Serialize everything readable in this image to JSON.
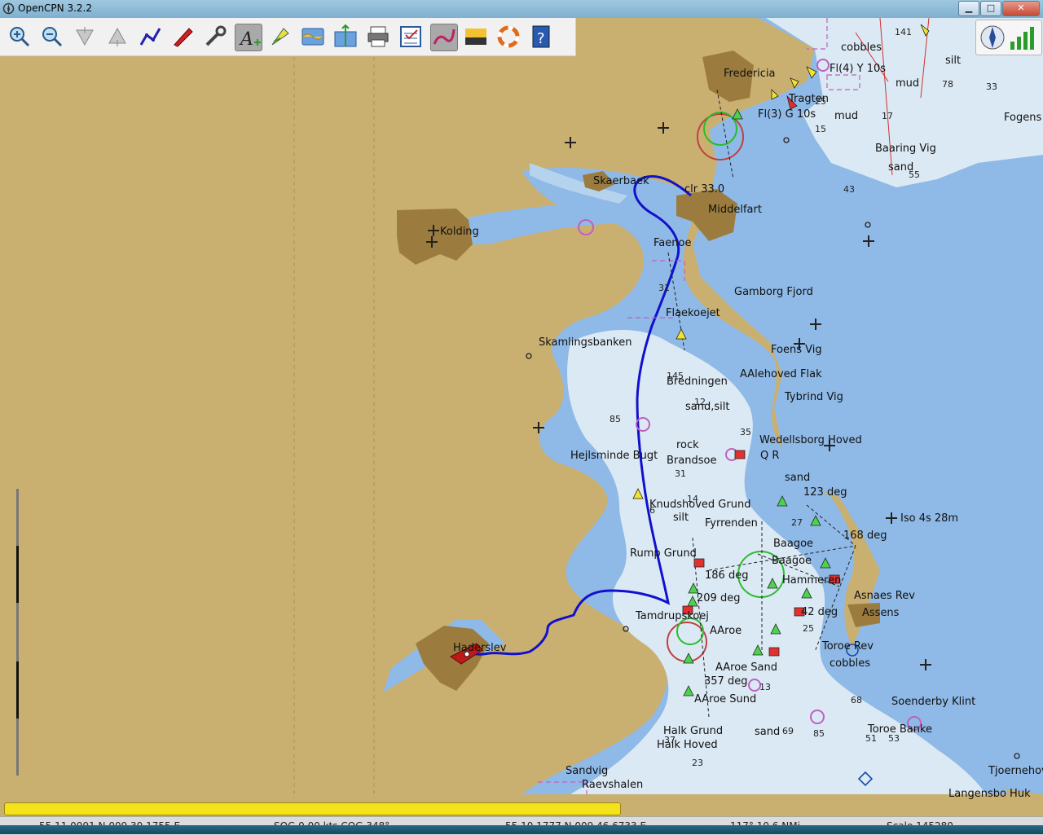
{
  "window": {
    "title": "OpenCPN 3.2.2",
    "minimize_glyph": "▁",
    "maximize_glyph": "□",
    "close_glyph": "✕"
  },
  "toolbar": {
    "tools": [
      {
        "name": "zoom-in",
        "icon": "zoom-in-icon"
      },
      {
        "name": "zoom-out",
        "icon": "zoom-out-icon"
      },
      {
        "name": "scale-in",
        "icon": "scale-in-icon"
      },
      {
        "name": "scale-out",
        "icon": "scale-out-icon"
      },
      {
        "name": "route",
        "icon": "route-icon"
      },
      {
        "name": "auto-follow",
        "icon": "ship-icon"
      },
      {
        "name": "settings",
        "icon": "settings-icon"
      },
      {
        "name": "text",
        "icon": "text-icon",
        "active": true
      },
      {
        "name": "current",
        "icon": "current-icon"
      },
      {
        "name": "tide",
        "icon": "tide-icon"
      },
      {
        "name": "ais",
        "icon": "ais-icon"
      },
      {
        "name": "print",
        "icon": "print-icon"
      },
      {
        "name": "route-manager",
        "icon": "route-manager-icon"
      },
      {
        "name": "track",
        "icon": "track-icon",
        "active": true
      },
      {
        "name": "color-scheme",
        "icon": "color-scheme-icon"
      },
      {
        "name": "mob",
        "icon": "mob-icon"
      },
      {
        "name": "help",
        "icon": "help-icon"
      }
    ]
  },
  "map": {
    "labels": [
      {
        "text": "Fredericia"
      },
      {
        "text": "Fl(4) Y 10s"
      },
      {
        "text": "Tragten"
      },
      {
        "text": "Fl(3) G 10s"
      },
      {
        "text": "cobbles"
      },
      {
        "text": "silt"
      },
      {
        "text": "mud"
      },
      {
        "text": "mud"
      },
      {
        "text": "Fogens"
      },
      {
        "text": "Baaring Vig"
      },
      {
        "text": "sand"
      },
      {
        "text": "Skaerbaek"
      },
      {
        "text": "clr 33.0"
      },
      {
        "text": "Middelfart"
      },
      {
        "text": "Kolding"
      },
      {
        "text": "Faenoe"
      },
      {
        "text": "Gamborg Fjord"
      },
      {
        "text": "Flaekoejet"
      },
      {
        "text": "Skamlingsbanken"
      },
      {
        "text": "Foens Vig"
      },
      {
        "text": "AAlehoved Flak"
      },
      {
        "text": "Bredningen"
      },
      {
        "text": "Tybrind Vig"
      },
      {
        "text": "sand,silt"
      },
      {
        "text": "Wedellsborg Hoved"
      },
      {
        "text": "rock"
      },
      {
        "text": "Q R"
      },
      {
        "text": "Hejlsminde Bugt"
      },
      {
        "text": "Brandsoe"
      },
      {
        "text": "sand"
      },
      {
        "text": "123 deg"
      },
      {
        "text": "Knudshoved Grund"
      },
      {
        "text": "silt"
      },
      {
        "text": "Iso 4s 28m"
      },
      {
        "text": "Fyrrenden"
      },
      {
        "text": "168 deg"
      },
      {
        "text": "Baagoe"
      },
      {
        "text": "Rump Grund"
      },
      {
        "text": "Baagoe"
      },
      {
        "text": "186 deg"
      },
      {
        "text": "Hammeren"
      },
      {
        "text": "Asnaes Rev"
      },
      {
        "text": "209 deg"
      },
      {
        "text": "42 deg"
      },
      {
        "text": "Assens"
      },
      {
        "text": "Tamdrupskoej"
      },
      {
        "text": "AAroe"
      },
      {
        "text": "Haderslev"
      },
      {
        "text": "Toroe Rev"
      },
      {
        "text": "cobbles"
      },
      {
        "text": "AAroe Sand"
      },
      {
        "text": "357 deg"
      },
      {
        "text": "AAroe Sund"
      },
      {
        "text": "Soenderby Klint"
      },
      {
        "text": "Halk Grund"
      },
      {
        "text": "sand"
      },
      {
        "text": "Toroe Banke"
      },
      {
        "text": "Halk Hoved"
      },
      {
        "text": "Sandvig"
      },
      {
        "text": "Tjoernehoved"
      },
      {
        "text": "Raevshalen"
      },
      {
        "text": "Langensbo Huk"
      }
    ],
    "soundings": [
      "141",
      "78",
      "33",
      "43",
      "55",
      "15",
      "17",
      "25",
      "31",
      "145",
      "12",
      "85",
      "35",
      "14",
      "27",
      "6",
      "37",
      "25",
      "51",
      "23",
      "85",
      "69",
      "53",
      "68",
      "13",
      "31"
    ]
  },
  "statusbar": {
    "ship_position": "55 11.0091 N   009 30.1755 E",
    "sog_cog": "SOG 0.00 kts   COG 348°",
    "cursor_position": "55 10.1777 N   009 46.6733 E",
    "range": "117° 10.6 NMi",
    "scale": "Scale 145280"
  },
  "progress": {
    "fraction": 0.59
  },
  "colors": {
    "land": "#c9b071",
    "shallow": "#8fb9e6",
    "mid": "#b6d3ee",
    "deep": "#dbe9f4",
    "track": "#1111cc"
  }
}
